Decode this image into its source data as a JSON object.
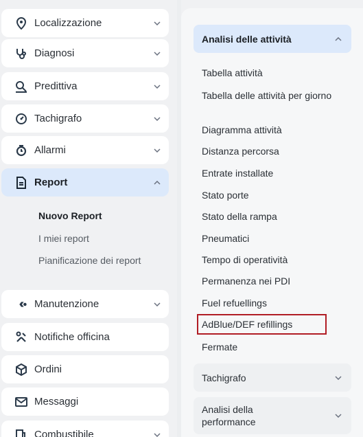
{
  "sidebar": {
    "items": [
      {
        "label": "Localizzazione",
        "icon": "location-pin-icon"
      },
      {
        "label": "Diagnosi",
        "icon": "stethoscope-icon"
      },
      {
        "label": "Predittiva",
        "icon": "predictive-chart-icon"
      },
      {
        "label": "Tachigrafo",
        "icon": "tachograph-icon"
      },
      {
        "label": "Allarmi",
        "icon": "alarm-clock-icon"
      },
      {
        "label": "Report",
        "icon": "document-icon"
      },
      {
        "label": "Manutenzione",
        "icon": "wrench-icon"
      },
      {
        "label": "Notifiche officina",
        "icon": "workshop-tools-icon"
      },
      {
        "label": "Ordini",
        "icon": "package-icon"
      },
      {
        "label": "Messaggi",
        "icon": "message-icon"
      },
      {
        "label": "Combustibile",
        "icon": "fuel-icon"
      }
    ],
    "report_subitems": [
      {
        "label": "Nuovo Report"
      },
      {
        "label": "I miei report"
      },
      {
        "label": "Pianificazione dei report"
      }
    ]
  },
  "panel": {
    "sections": [
      {
        "label": "Analisi delle attività"
      },
      {
        "label": "Tachigrafo"
      },
      {
        "label": "Analisi della performance"
      }
    ],
    "activity_items": [
      {
        "label": "Tabella attività"
      },
      {
        "label": "Tabella delle attività per giorno"
      },
      {
        "label": "Diagramma attività"
      },
      {
        "label": "Distanza percorsa"
      },
      {
        "label": "Entrate installate"
      },
      {
        "label": "Stato porte"
      },
      {
        "label": "Stato della rampa"
      },
      {
        "label": "Pneumatici"
      },
      {
        "label": "Tempo di operatività"
      },
      {
        "label": "Permanenza nei PDI"
      },
      {
        "label": "Fuel refuellings"
      },
      {
        "label": "AdBlue/DEF refillings"
      },
      {
        "label": "Fermate"
      }
    ]
  },
  "colors": {
    "accent_active": "#dce9fb",
    "highlight": "#b01c24",
    "icon": "#2b3a4a"
  }
}
